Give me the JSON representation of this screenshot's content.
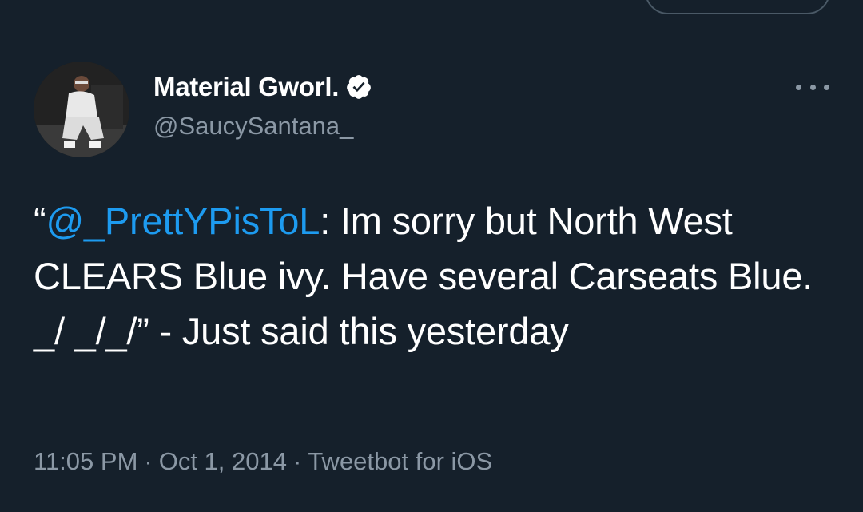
{
  "author": {
    "display_name": "Material Gworl.",
    "handle": "@SaucySantana_",
    "verified": true
  },
  "tweet": {
    "open_quote": "“",
    "mention": "@_PrettYPisToL",
    "text_after_mention": ": Im sorry but North West CLEARS Blue ivy. Have several Carseats Blue. _/ _/_/” - Just said this yesterday"
  },
  "meta": {
    "time": "11:05 PM",
    "separator": "·",
    "date": "Oct 1, 2014",
    "source": "Tweetbot for iOS"
  },
  "icons": {
    "verified": "verified-badge-icon",
    "more": "more-options-icon"
  },
  "colors": {
    "background": "#15202b",
    "text": "#ffffff",
    "secondary": "#8b98a5",
    "link": "#1d9bf0"
  }
}
